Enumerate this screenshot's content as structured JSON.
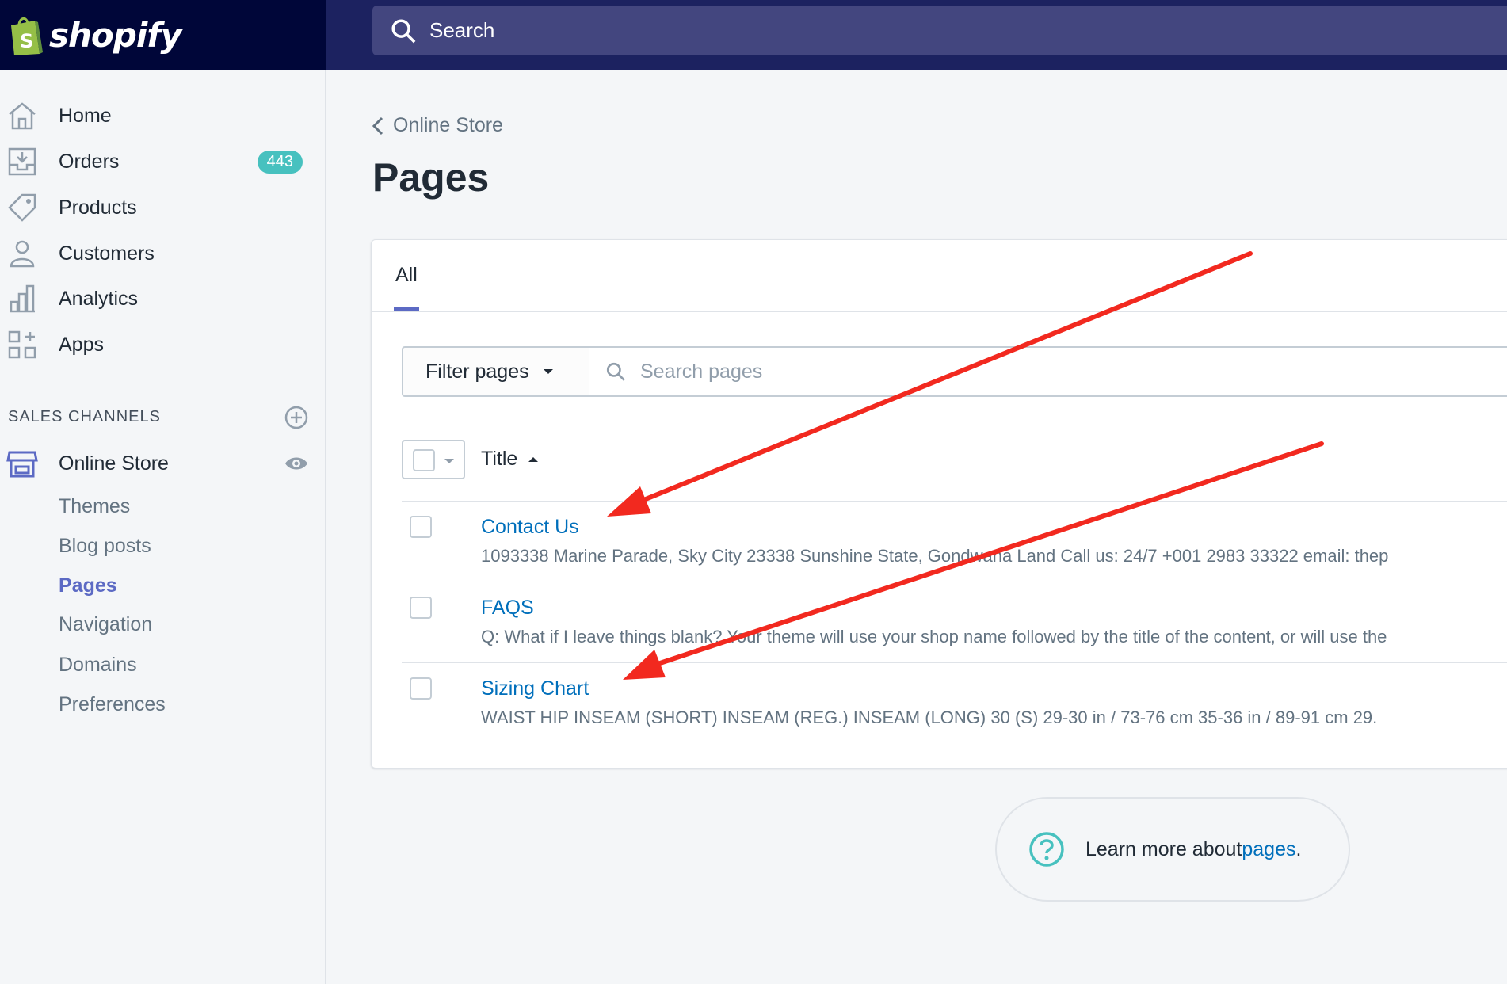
{
  "brand": {
    "name": "shopify"
  },
  "topbar": {
    "search_placeholder": "Search"
  },
  "sidebar": {
    "items": [
      {
        "label": "Home"
      },
      {
        "label": "Orders",
        "badge": "443"
      },
      {
        "label": "Products"
      },
      {
        "label": "Customers"
      },
      {
        "label": "Analytics"
      },
      {
        "label": "Apps"
      }
    ],
    "sales_channels_label": "SALES CHANNELS",
    "online_store": {
      "label": "Online Store",
      "subitems": [
        "Themes",
        "Blog posts",
        "Pages",
        "Navigation",
        "Domains",
        "Preferences"
      ],
      "active": "Pages"
    }
  },
  "main": {
    "breadcrumb": "Online Store",
    "title": "Pages",
    "tab": "All",
    "filter_label": "Filter pages",
    "search_placeholder": "Search pages",
    "column_title": "Title",
    "rows": [
      {
        "title": "Contact Us",
        "snippet": "1093338 Marine Parade, Sky City 23338 Sunshine State, Gondwana Land  Call us: 24/7 +001 2983 33322 email: thep"
      },
      {
        "title": "FAQS",
        "snippet": "Q: What if I leave things blank? Your theme will use your shop name followed by the title of the content, or will use the"
      },
      {
        "title": "Sizing Chart",
        "snippet": "WAIST  HIP  INSEAM (SHORT) INSEAM (REG.) INSEAM (LONG) 30 (S) 29-30 in / 73-76 cm   35-36 in / 89-91 cm    29."
      }
    ],
    "help": {
      "text": "Learn more about ",
      "link": "pages",
      "suffix": "."
    }
  },
  "colors": {
    "topbar": "#1c2260",
    "brand_bg": "#000639",
    "accent": "#5c6ac4",
    "link": "#006fbb",
    "badge": "#47c1bf",
    "annotation_arrow": "#f2291f"
  }
}
